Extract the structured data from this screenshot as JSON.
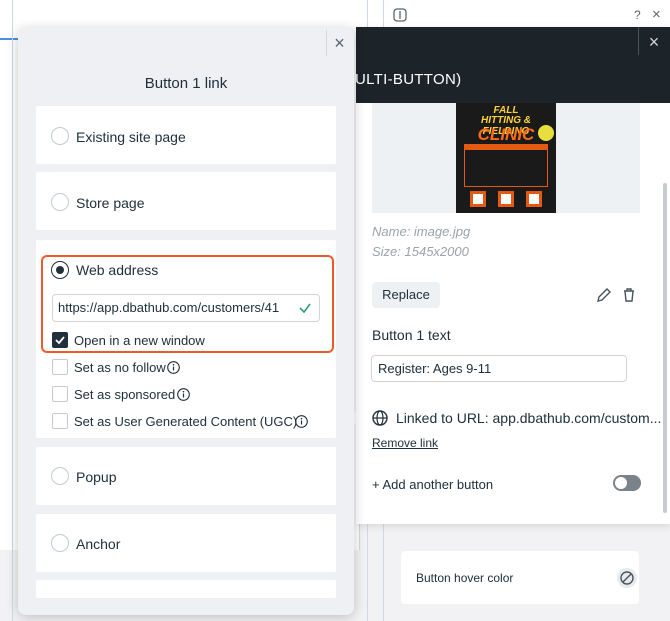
{
  "background": {
    "top_help_glyph": "?",
    "top_close_glyph": "×"
  },
  "settings_panel": {
    "title": "ULTI-BUTTON)",
    "close_glyph": "×",
    "image": {
      "flyer_line1": "FALL",
      "flyer_line2": "HITTING & FIELDING",
      "flyer_line3": "CLINIC",
      "name": "Name: image.jpg",
      "size": "Size: 1545x2000"
    },
    "replace_label": "Replace",
    "button_text_label": "Button 1 text",
    "button_text_value": "Register: Ages 9-11",
    "linked_text": "Linked to URL: app.dbathub.com/custom...",
    "remove_link": "Remove link",
    "add_button": "+ Add another button",
    "hover_color_label": "Button hover color"
  },
  "link_modal": {
    "title": "Button 1 link",
    "close_glyph": "×",
    "options": {
      "existing": "Existing site page",
      "store": "Store page",
      "web": "Web address",
      "popup": "Popup",
      "anchor": "Anchor"
    },
    "selected": "Web address",
    "url_value": "https://app.dbathub.com/customers/41",
    "checkboxes": {
      "new_window": "Open in a new window",
      "no_follow": "Set as no follow",
      "sponsored": "Set as sponsored",
      "ugc": "Set as User Generated Content (UGC)"
    },
    "new_window_checked": true
  },
  "colors": {
    "highlight": "#f05a28",
    "dark_header": "#1c2329",
    "text": "#20303c",
    "valid_check": "#2f9e6e"
  }
}
